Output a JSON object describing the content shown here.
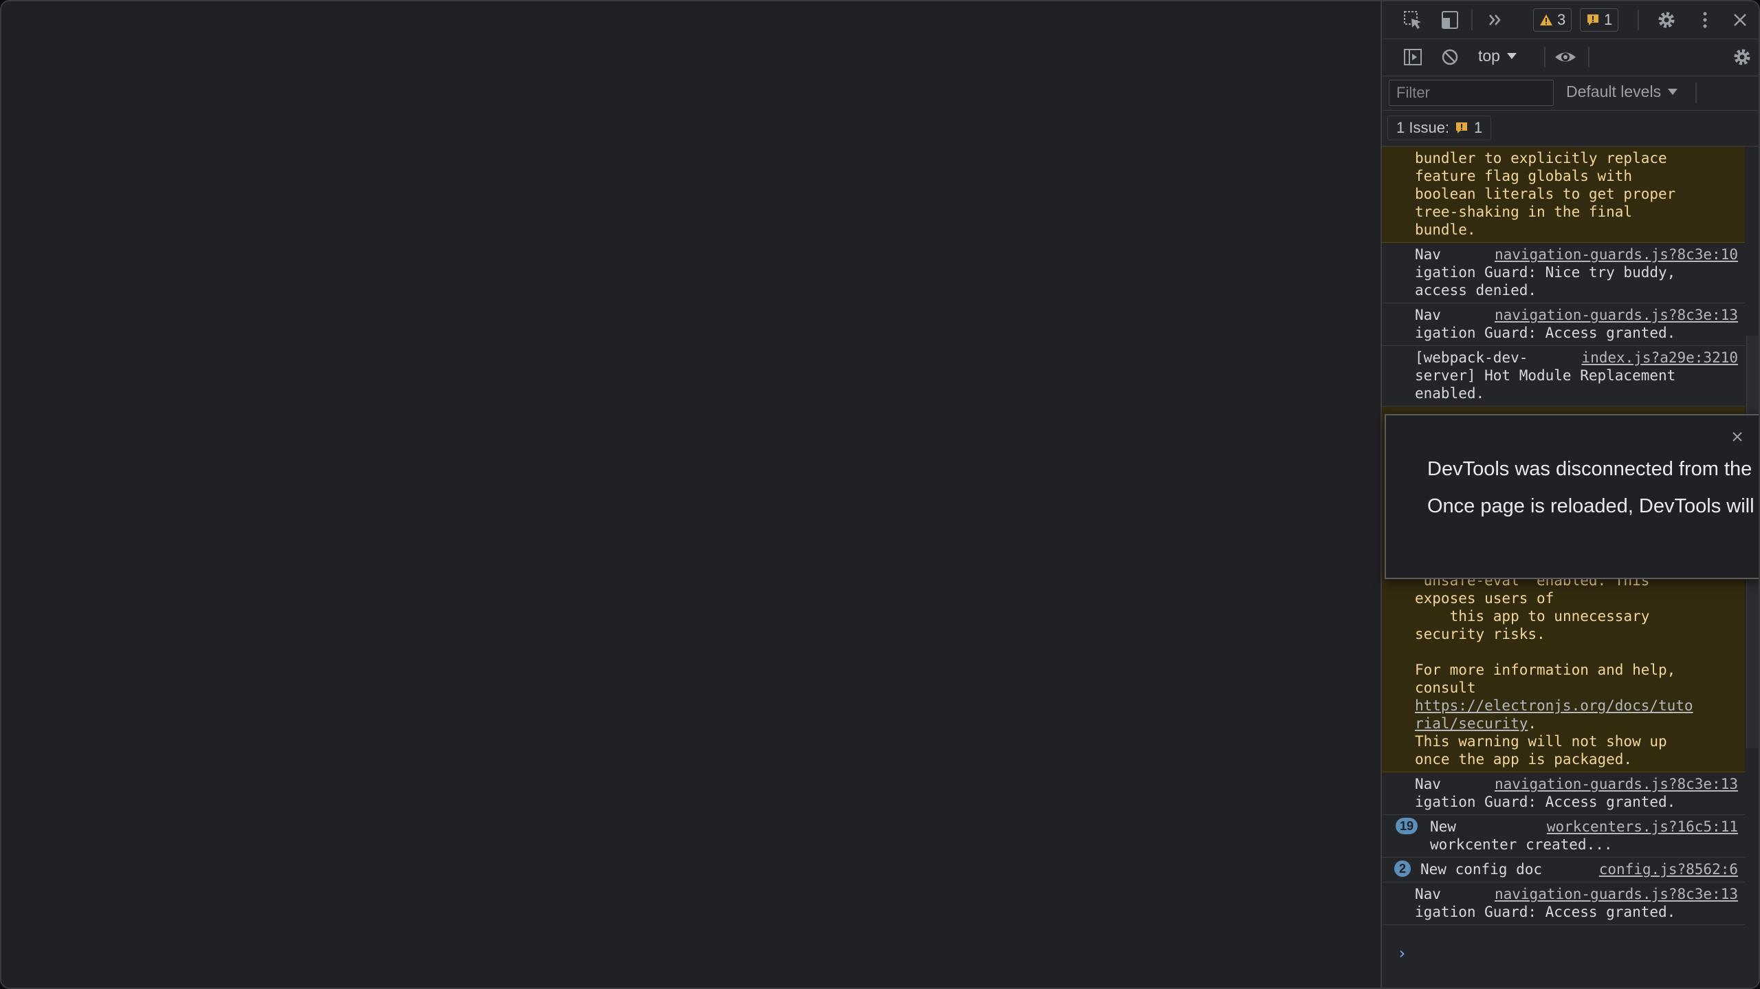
{
  "toolbar": {
    "warnings_count": "3",
    "issues_count": "1"
  },
  "console_toolbar": {
    "context": "top"
  },
  "filter": {
    "placeholder": "Filter",
    "levels_label": "Default levels"
  },
  "issues": {
    "label": "1 Issue:",
    "count": "1"
  },
  "messages": [
    {
      "text": "bundler to explicitly replace\nfeature flag globals with\nboolean literals to get proper\ntree-shaking in the final\nbundle.",
      "source": ""
    },
    {
      "text": "Nav\nigation Guard: Nice try buddy,\naccess denied.",
      "source": "navigation-guards.js?8c3e:10"
    },
    {
      "text": "Nav\nigation Guard: Access granted.",
      "source": "navigation-guards.js?8c3e:13"
    },
    {
      "text": "[webpack-dev-\nserver] Hot Module Replacement\nenabled.",
      "source": "index.js?a29e:3210"
    },
    {
      "text": "\"unsafe-eval\" enabled. This\nexposes users of\n    this app to unnecessary\nsecurity risks.\n\nFor more information and help,\nconsult",
      "link": "https://electronjs.org/docs/tuto\nrial/security",
      "after_link": ".\nThis warning will not show up\nonce the app is packaged."
    },
    {
      "text": "Nav\nigation Guard: Access granted.",
      "source": "navigation-guards.js?8c3e:13"
    },
    {
      "count": "19",
      "text": "New\nworkcenter created...",
      "source": "workcenters.js?16c5:11"
    },
    {
      "count": "2",
      "text": "New config doc",
      "source": "config.js?8562:6"
    },
    {
      "text": "Nav\nigation Guard: Access granted.",
      "source": "navigation-guards.js?8c3e:13"
    }
  ],
  "dialog": {
    "title": "DevTools was disconnected from the page.",
    "body": "Once page is reloaded, DevTools will automatically reconnect."
  },
  "colors": {
    "warning_background": "#332b10",
    "warning_text": "#f2d59a",
    "count_badge": "#5a8db8",
    "prompt": "#7cacf8"
  }
}
